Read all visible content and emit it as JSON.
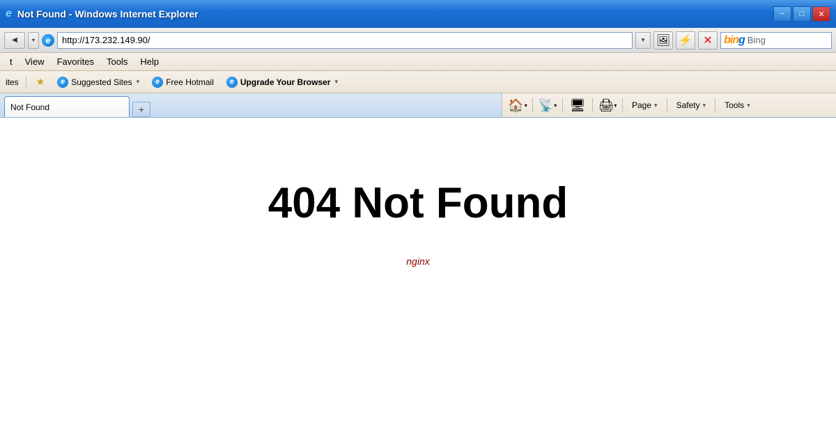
{
  "titleBar": {
    "title": "Not Found - Windows Internet Explorer",
    "minimize": "−",
    "maximize": "□",
    "close": "✕"
  },
  "addressBar": {
    "url": "http://173.232.149.90/",
    "searchEngine": "Bing"
  },
  "menuBar": {
    "items": [
      "t",
      "View",
      "Favorites",
      "Tools",
      "Help"
    ]
  },
  "favoritesBar": {
    "label": "ites",
    "items": [
      {
        "label": "Suggested Sites",
        "hasDropdown": true
      },
      {
        "label": "Free Hotmail",
        "hasDropdown": false
      },
      {
        "label": "Upgrade Your Browser",
        "hasDropdown": true,
        "bold": true
      }
    ]
  },
  "tabs": [
    {
      "label": "Not Found",
      "active": true
    }
  ],
  "commandBar": {
    "home": "🏠",
    "rss": "📶",
    "view": "🖥",
    "print": "🖨",
    "page": "Page",
    "safety": "Safety",
    "tools": "Tools"
  },
  "pageContent": {
    "heading": "404 Not Found",
    "footer": "nginx"
  },
  "icons": {
    "back": "◀",
    "forward": "▼",
    "refresh": "⟳",
    "stop": "✕",
    "dropdown": "▾",
    "chevron": "▾",
    "new_tab": "+"
  }
}
